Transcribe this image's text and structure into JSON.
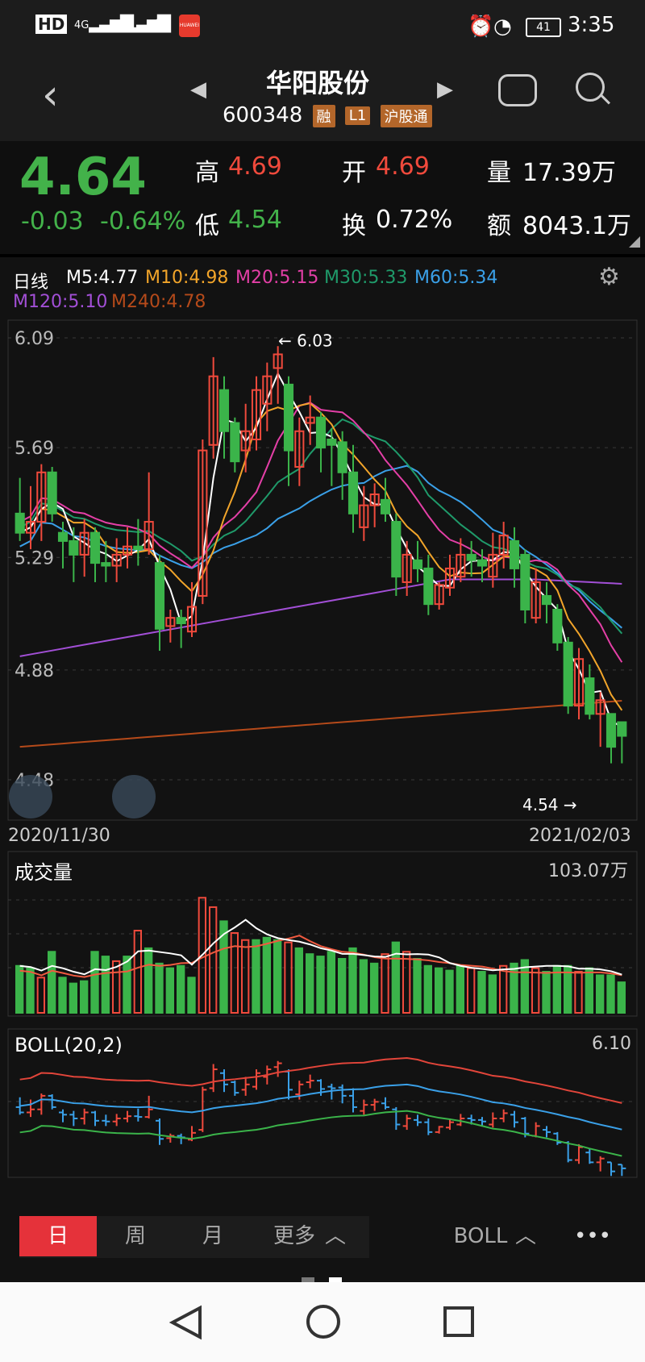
{
  "status_bar": {
    "left_icons": [
      "HD",
      "4G",
      "2G",
      "wifi",
      "HUAWEI"
    ],
    "battery": "41",
    "time": "3:35"
  },
  "header": {
    "title": "华阳股份",
    "code": "600348",
    "tags": [
      "融",
      "L1",
      "沪股通"
    ]
  },
  "quote": {
    "price": "4.64",
    "change": "-0.03",
    "change_pct": "-0.64%",
    "high_label": "高",
    "high": "4.69",
    "low_label": "低",
    "low": "4.54",
    "open_label": "开",
    "open": "4.69",
    "turnover_label": "换",
    "turnover": "0.72%",
    "volume_label": "量",
    "volume": "17.39万",
    "amount_label": "额",
    "amount": "8043.1万"
  },
  "ma_legend": {
    "period": "日线",
    "m5": "M5:4.77",
    "m10": "M10:4.98",
    "m20": "M20:5.15",
    "m30": "M30:5.33",
    "m60": "M60:5.34",
    "m120": "M120:5.10",
    "m240": "M240:4.78"
  },
  "colors": {
    "up": "#f04a3c",
    "down": "#3bb44a",
    "m5": "#ffffff",
    "m10": "#f2a52a",
    "m20": "#e43fa7",
    "m30": "#1f9a6a",
    "m60": "#3aa0e8",
    "m120": "#a24fd6",
    "m240": "#b54a1a"
  },
  "chart_data": [
    {
      "type": "candlestick",
      "y_ticks": [
        "6.09",
        "5.69",
        "5.29",
        "4.88",
        "4.48"
      ],
      "ylim": [
        4.48,
        6.09
      ],
      "x_start": "2020/11/30",
      "x_end": "2021/02/03",
      "max_label": "6.03",
      "min_label": "4.54",
      "candles": [
        [
          5.45,
          5.38,
          5.58,
          5.35
        ],
        [
          5.38,
          5.42,
          5.55,
          5.32
        ],
        [
          5.42,
          5.6,
          5.63,
          5.35
        ],
        [
          5.6,
          5.45,
          5.62,
          5.42
        ],
        [
          5.38,
          5.35,
          5.42,
          5.25
        ],
        [
          5.35,
          5.3,
          5.4,
          5.2
        ],
        [
          5.3,
          5.38,
          5.43,
          5.22
        ],
        [
          5.38,
          5.27,
          5.4,
          5.2
        ],
        [
          5.27,
          5.26,
          5.35,
          5.2
        ],
        [
          5.26,
          5.3,
          5.36,
          5.2
        ],
        [
          5.3,
          5.33,
          5.4,
          5.25
        ],
        [
          5.33,
          5.32,
          5.43,
          5.26
        ],
        [
          5.32,
          5.42,
          5.6,
          5.3
        ],
        [
          5.27,
          5.03,
          5.3,
          4.95
        ],
        [
          5.04,
          5.07,
          5.1,
          4.98
        ],
        [
          5.07,
          5.05,
          5.1,
          4.96
        ],
        [
          5.02,
          5.11,
          5.2,
          5.0
        ],
        [
          5.15,
          5.68,
          5.72,
          5.12
        ],
        [
          5.7,
          5.95,
          6.02,
          5.65
        ],
        [
          5.9,
          5.75,
          5.95,
          5.65
        ],
        [
          5.78,
          5.64,
          5.8,
          5.6
        ],
        [
          5.68,
          5.75,
          5.85,
          5.6
        ],
        [
          5.72,
          5.9,
          5.95,
          5.68
        ],
        [
          5.85,
          5.95,
          6.0,
          5.75
        ],
        [
          5.98,
          6.03,
          6.06,
          5.85
        ],
        [
          5.92,
          5.68,
          5.95,
          5.55
        ],
        [
          5.62,
          5.75,
          5.8,
          5.55
        ],
        [
          5.78,
          5.8,
          5.88,
          5.7
        ],
        [
          5.8,
          5.69,
          5.82,
          5.6
        ],
        [
          5.72,
          5.7,
          5.76,
          5.55
        ],
        [
          5.71,
          5.6,
          5.75,
          5.5
        ],
        [
          5.6,
          5.45,
          5.7,
          5.38
        ],
        [
          5.4,
          5.48,
          5.55,
          5.35
        ],
        [
          5.48,
          5.52,
          5.56,
          5.4
        ],
        [
          5.5,
          5.45,
          5.58,
          5.42
        ],
        [
          5.42,
          5.22,
          5.45,
          5.15
        ],
        [
          5.2,
          5.3,
          5.35,
          5.15
        ],
        [
          5.28,
          5.25,
          5.35,
          5.2
        ],
        [
          5.25,
          5.12,
          5.3,
          5.08
        ],
        [
          5.12,
          5.19,
          5.2,
          5.1
        ],
        [
          5.18,
          5.25,
          5.3,
          5.15
        ],
        [
          5.22,
          5.3,
          5.36,
          5.2
        ],
        [
          5.3,
          5.28,
          5.35,
          5.22
        ],
        [
          5.28,
          5.26,
          5.32,
          5.2
        ],
        [
          5.22,
          5.3,
          5.38,
          5.18
        ],
        [
          5.3,
          5.37,
          5.42,
          5.25
        ],
        [
          5.35,
          5.25,
          5.4,
          5.18
        ],
        [
          5.3,
          5.1,
          5.32,
          5.05
        ],
        [
          5.07,
          5.2,
          5.25,
          5.05
        ],
        [
          5.15,
          5.12,
          5.2,
          5.05
        ],
        [
          5.1,
          4.98,
          5.12,
          4.95
        ],
        [
          4.98,
          4.75,
          5.0,
          4.72
        ],
        [
          4.75,
          4.92,
          4.96,
          4.7
        ],
        [
          4.85,
          4.72,
          4.9,
          4.7
        ],
        [
          4.72,
          4.77,
          4.8,
          4.6
        ],
        [
          4.72,
          4.6,
          4.72,
          4.54
        ],
        [
          4.69,
          4.64,
          4.69,
          4.54
        ]
      ]
    },
    {
      "type": "bar",
      "title": "成交量",
      "max_label": "103.07万",
      "values": [
        40,
        38,
        30,
        52,
        30,
        25,
        27,
        52,
        48,
        44,
        48,
        70,
        55,
        42,
        38,
        40,
        30,
        98,
        90,
        78,
        68,
        62,
        62,
        64,
        62,
        60,
        55,
        50,
        48,
        52,
        46,
        55,
        45,
        42,
        50,
        60,
        52,
        46,
        40,
        38,
        36,
        40,
        38,
        35,
        32,
        40,
        42,
        45,
        38,
        35,
        40,
        40,
        35,
        38,
        32,
        32,
        26
      ],
      "up_days": [
        2,
        9,
        11,
        17,
        18,
        20,
        21,
        25,
        34,
        36,
        42,
        45,
        48,
        52
      ]
    },
    {
      "type": "line",
      "title": "BOLL(20,2)",
      "max_label": "6.10"
    }
  ],
  "tabs": {
    "day": "日",
    "week": "周",
    "month": "月",
    "more": "更多",
    "indicator": "BOLL",
    "overflow": "•••"
  }
}
